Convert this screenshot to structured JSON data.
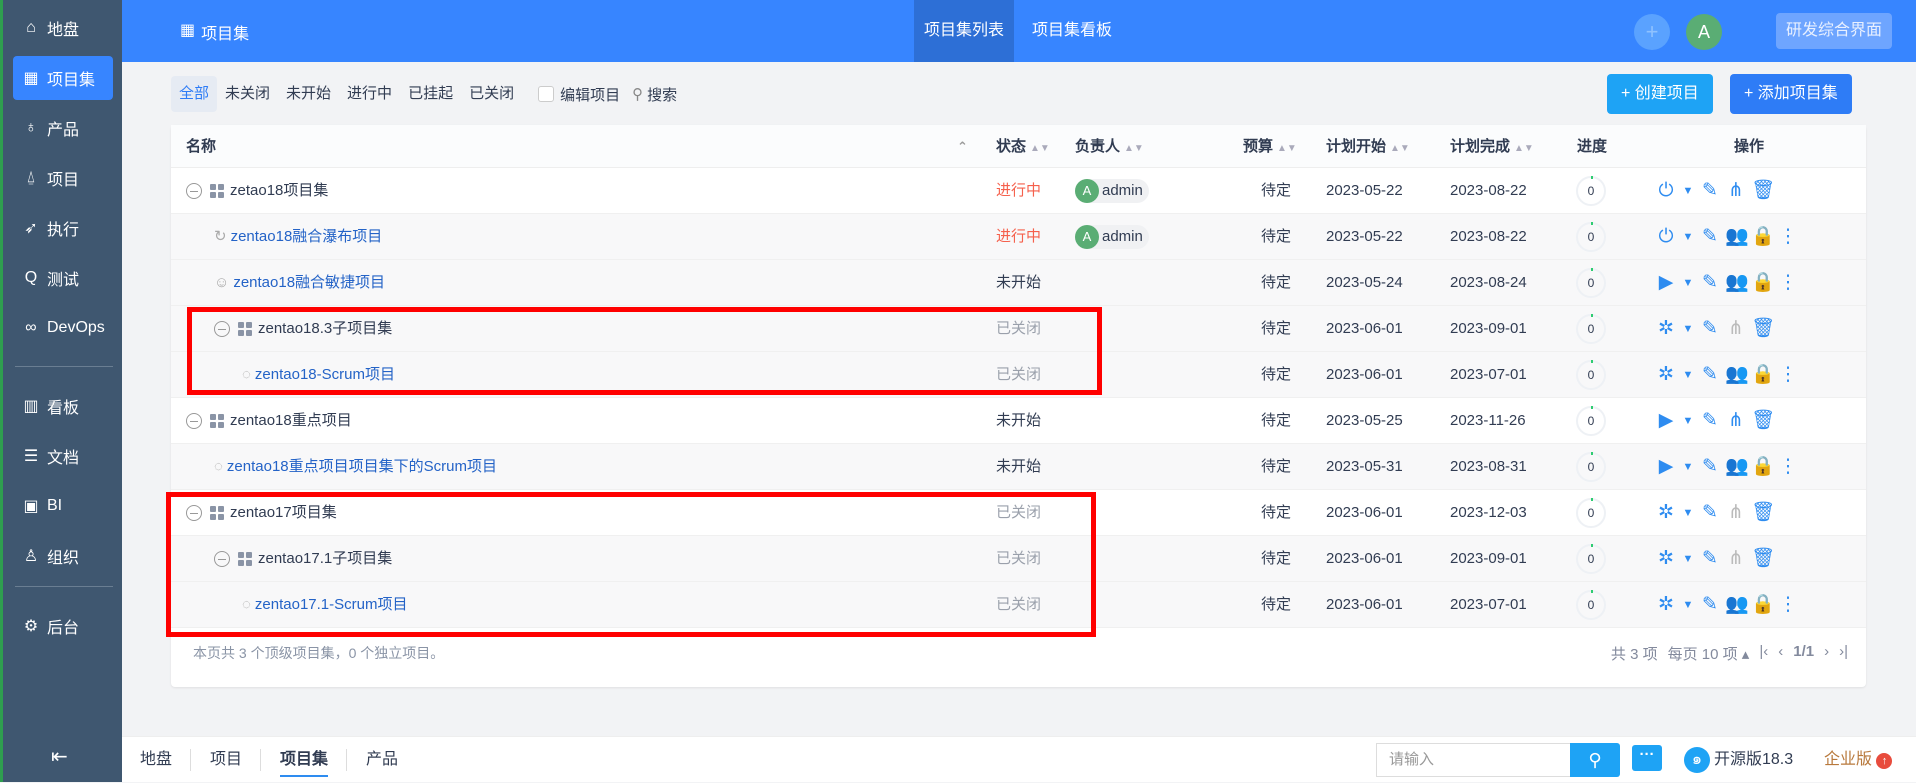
{
  "sidebar": {
    "items": [
      {
        "label": "地盘",
        "icon": "home-icon",
        "glyph": "⌂"
      },
      {
        "label": "项目集",
        "icon": "grid-icon",
        "glyph": "▦",
        "active": true
      },
      {
        "label": "产品",
        "icon": "lightbulb-icon",
        "glyph": "♁"
      },
      {
        "label": "项目",
        "icon": "rocket-icon",
        "glyph": "⍙"
      },
      {
        "label": "执行",
        "icon": "run-icon",
        "glyph": "➶"
      },
      {
        "label": "测试",
        "icon": "search-icon",
        "glyph": "Q"
      },
      {
        "label": "DevOps",
        "icon": "infinity-icon",
        "glyph": "∞"
      },
      {
        "label": "看板",
        "icon": "kanban-icon",
        "glyph": "▥"
      },
      {
        "label": "文档",
        "icon": "doc-icon",
        "glyph": "☰"
      },
      {
        "label": "BI",
        "icon": "chart-icon",
        "glyph": "▣"
      },
      {
        "label": "组织",
        "icon": "people-icon",
        "glyph": "♙"
      },
      {
        "label": "后台",
        "icon": "gear-icon",
        "glyph": "⚙"
      }
    ],
    "collapse_glyph": "⇤"
  },
  "header": {
    "title": "项目集",
    "tabs": [
      "项目集列表",
      "项目集看板"
    ],
    "avatar": "A",
    "add_glyph": "+",
    "switch_label": "研发综合界面"
  },
  "filters": {
    "items": [
      "全部",
      "未关闭",
      "未开始",
      "进行中",
      "已挂起",
      "已关闭"
    ],
    "edit_label": "编辑项目",
    "search_label": "搜索"
  },
  "buttons": {
    "create": "+ 创建项目",
    "add_set": "+ 添加项目集",
    "create_color": "#1ea3f5",
    "add_color": "#2e7cf6"
  },
  "table": {
    "columns": [
      "名称",
      "状态",
      "负责人",
      "预算",
      "计划开始",
      "计划完成",
      "进度",
      "操作"
    ],
    "rows": [
      {
        "name": "zetao18项目集",
        "type": "set",
        "level": 0,
        "status": "进行中",
        "owner": "admin",
        "budget": "待定",
        "start": "2023-05-22",
        "end": "2023-08-22",
        "progress": 0,
        "action": "power"
      },
      {
        "name": "zentao18融合瀑布项目",
        "type": "waterfall",
        "level": 1,
        "status": "进行中",
        "owner": "admin",
        "budget": "待定",
        "start": "2023-05-22",
        "end": "2023-08-22",
        "progress": 0,
        "action": "power"
      },
      {
        "name": "zentao18融合敏捷项目",
        "type": "agile",
        "level": 1,
        "status": "未开始",
        "owner": "",
        "budget": "待定",
        "start": "2023-05-24",
        "end": "2023-08-24",
        "progress": 0,
        "action": "play"
      },
      {
        "name": "zentao18.3子项目集",
        "type": "set",
        "level": 1,
        "status": "已关闭",
        "owner": "",
        "budget": "待定",
        "start": "2023-06-01",
        "end": "2023-09-01",
        "progress": 0,
        "action": "wand"
      },
      {
        "name": "zentao18-Scrum项目",
        "type": "scrum",
        "level": 2,
        "status": "已关闭",
        "owner": "",
        "budget": "待定",
        "start": "2023-06-01",
        "end": "2023-07-01",
        "progress": 0,
        "action": "wand"
      },
      {
        "name": "zentao18重点项目",
        "type": "set",
        "level": 0,
        "status": "未开始",
        "owner": "",
        "budget": "待定",
        "start": "2023-05-25",
        "end": "2023-11-26",
        "progress": 0,
        "action": "play"
      },
      {
        "name": "zentao18重点项目项目集下的Scrum项目",
        "type": "scrum",
        "level": 1,
        "status": "未开始",
        "owner": "",
        "budget": "待定",
        "start": "2023-05-31",
        "end": "2023-08-31",
        "progress": 0,
        "action": "play"
      },
      {
        "name": "zentao17项目集",
        "type": "set",
        "level": 0,
        "status": "已关闭",
        "owner": "",
        "budget": "待定",
        "start": "2023-06-01",
        "end": "2023-12-03",
        "progress": 0,
        "action": "wand"
      },
      {
        "name": "zentao17.1子项目集",
        "type": "set",
        "level": 1,
        "status": "已关闭",
        "owner": "",
        "budget": "待定",
        "start": "2023-06-01",
        "end": "2023-09-01",
        "progress": 0,
        "action": "wand"
      },
      {
        "name": "zentao17.1-Scrum项目",
        "type": "scrum",
        "level": 2,
        "status": "已关闭",
        "owner": "",
        "budget": "待定",
        "start": "2023-06-01",
        "end": "2023-07-01",
        "progress": 0,
        "action": "wand"
      }
    ],
    "summary": "本页共 3 个顶级项目集，0 个独立项目。",
    "pager": {
      "total": "共 3 项",
      "per_page": "每页 10 项",
      "page": "1/1"
    }
  },
  "status_colors": {
    "进行中": "#f5604c",
    "未开始": "#313c52",
    "已关闭": "#9aa0ab"
  },
  "bottom": {
    "nav": [
      "地盘",
      "项目",
      "项目集",
      "产品"
    ],
    "active": "项目集",
    "search_placeholder": "请输入",
    "version": "开源版18.3",
    "enterprise": "企业版"
  }
}
